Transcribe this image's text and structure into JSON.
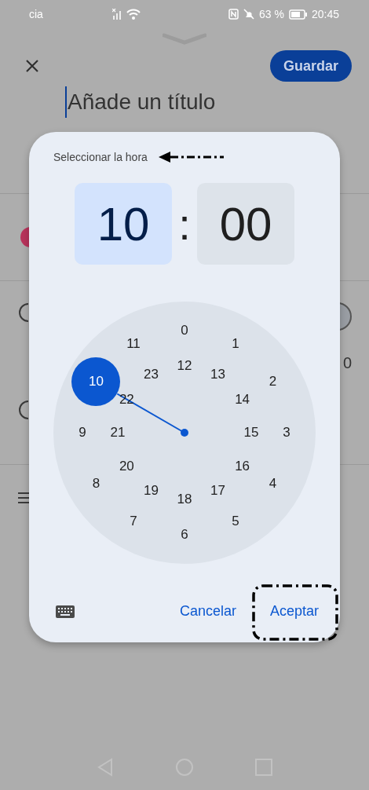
{
  "status_bar": {
    "carrier": "cia",
    "battery": "63 %",
    "time": "20:45"
  },
  "editor": {
    "save_button": "Guardar",
    "title_placeholder": "Añade un título",
    "toggle_on": false,
    "partial_value": "0"
  },
  "time_picker": {
    "title": "Seleccionar la hora",
    "title_pointed_at": true,
    "hour": {
      "value": "10",
      "selected": true
    },
    "separator": ":",
    "minute": {
      "value": "00",
      "selected": false
    },
    "dial": [
      {
        "label": "0",
        "selected": false
      },
      {
        "label": "1",
        "selected": false
      },
      {
        "label": "2",
        "selected": false
      },
      {
        "label": "3",
        "selected": false
      },
      {
        "label": "4",
        "selected": false
      },
      {
        "label": "5",
        "selected": false
      },
      {
        "label": "6",
        "selected": false
      },
      {
        "label": "7",
        "selected": false
      },
      {
        "label": "8",
        "selected": false
      },
      {
        "label": "9",
        "selected": false
      },
      {
        "label": "10",
        "selected": true
      },
      {
        "label": "11",
        "selected": false
      },
      {
        "label": "12",
        "selected": false
      },
      {
        "label": "13",
        "selected": false
      },
      {
        "label": "14",
        "selected": false
      },
      {
        "label": "15",
        "selected": false
      },
      {
        "label": "16",
        "selected": false
      },
      {
        "label": "17",
        "selected": false
      },
      {
        "label": "18",
        "selected": false
      },
      {
        "label": "19",
        "selected": false
      },
      {
        "label": "20",
        "selected": false
      },
      {
        "label": "21",
        "selected": false
      },
      {
        "label": "22",
        "selected": false
      },
      {
        "label": "23",
        "selected": false
      }
    ],
    "actions": [
      {
        "label": "Cancelar",
        "highlighted": false
      },
      {
        "label": "Aceptar",
        "highlighted": true
      }
    ]
  }
}
